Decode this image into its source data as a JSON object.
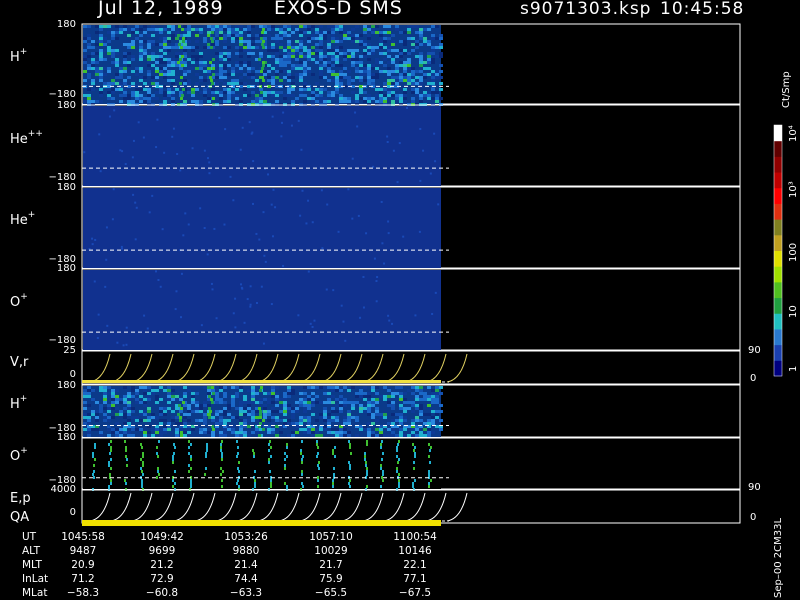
{
  "header": {
    "date": "Jul 12, 1989",
    "instrument": "EXOS-D SMS",
    "file": "s9071303.ksp",
    "time": "10:45:58"
  },
  "panels": [
    {
      "id": "h1",
      "species": "H",
      "charge": "+",
      "top_tick": "180",
      "bottom_tick": "−180",
      "base_color": "#0b3a8a",
      "noise": "high"
    },
    {
      "id": "he2",
      "species": "He",
      "charge": "++",
      "top_tick": "180",
      "bottom_tick": "−180",
      "base_color": "#11318f",
      "noise": "low"
    },
    {
      "id": "he1",
      "species": "He",
      "charge": "+",
      "top_tick": "180",
      "bottom_tick": "−180",
      "base_color": "#11318f",
      "noise": "low"
    },
    {
      "id": "o1",
      "species": "O",
      "charge": "+",
      "top_tick": "180",
      "bottom_tick": "−180",
      "base_color": "#11318f",
      "noise": "low"
    },
    {
      "id": "vr",
      "species": "V,r",
      "charge": "",
      "top_tick": "25",
      "bottom_tick": "0",
      "right_top": "90",
      "right_bottom": "0"
    },
    {
      "id": "h2",
      "species": "H",
      "charge": "+",
      "top_tick": "180",
      "bottom_tick": "−180",
      "base_color": "#0b3a8a",
      "noise": "high"
    },
    {
      "id": "o2",
      "species": "O",
      "charge": "+",
      "top_tick": "180",
      "bottom_tick": "−180",
      "base_color": "#000000",
      "noise": "stripes"
    },
    {
      "id": "ep",
      "species": "E,p",
      "charge": "",
      "top_tick": "4000",
      "bottom_tick": "0",
      "right_top": "90",
      "right_bottom": "0",
      "extra_label": "QA"
    }
  ],
  "colorbar": {
    "unit": "Ct/Smp",
    "ticks": [
      "1",
      "10",
      "100",
      "10³",
      "10⁴"
    ],
    "colors": [
      "#000080",
      "#1a40b0",
      "#2a7ad0",
      "#20c0c0",
      "#20a040",
      "#50c020",
      "#a0e000",
      "#e0e000",
      "#c0a020",
      "#808020",
      "#e03010",
      "#ff0000",
      "#c00000",
      "#900000",
      "#600000",
      "#ffffff"
    ]
  },
  "orbit_table": {
    "labels": [
      "UT",
      "ALT",
      "MLT",
      "InLat",
      "MLat"
    ],
    "columns": [
      [
        "1045:58",
        "9487",
        "20.9",
        "71.2",
        "−58.3"
      ],
      [
        "1049:42",
        "9699",
        "21.2",
        "72.9",
        "−60.8"
      ],
      [
        "1053:26",
        "9880",
        "21.4",
        "74.4",
        "−63.3"
      ],
      [
        "1057:10",
        "10029",
        "21.7",
        "75.9",
        "−65.5"
      ],
      [
        "1100:54",
        "10146",
        "22.1",
        "77.1",
        "−67.5"
      ]
    ]
  },
  "footer_code": "Sep–00 2CM33L"
}
